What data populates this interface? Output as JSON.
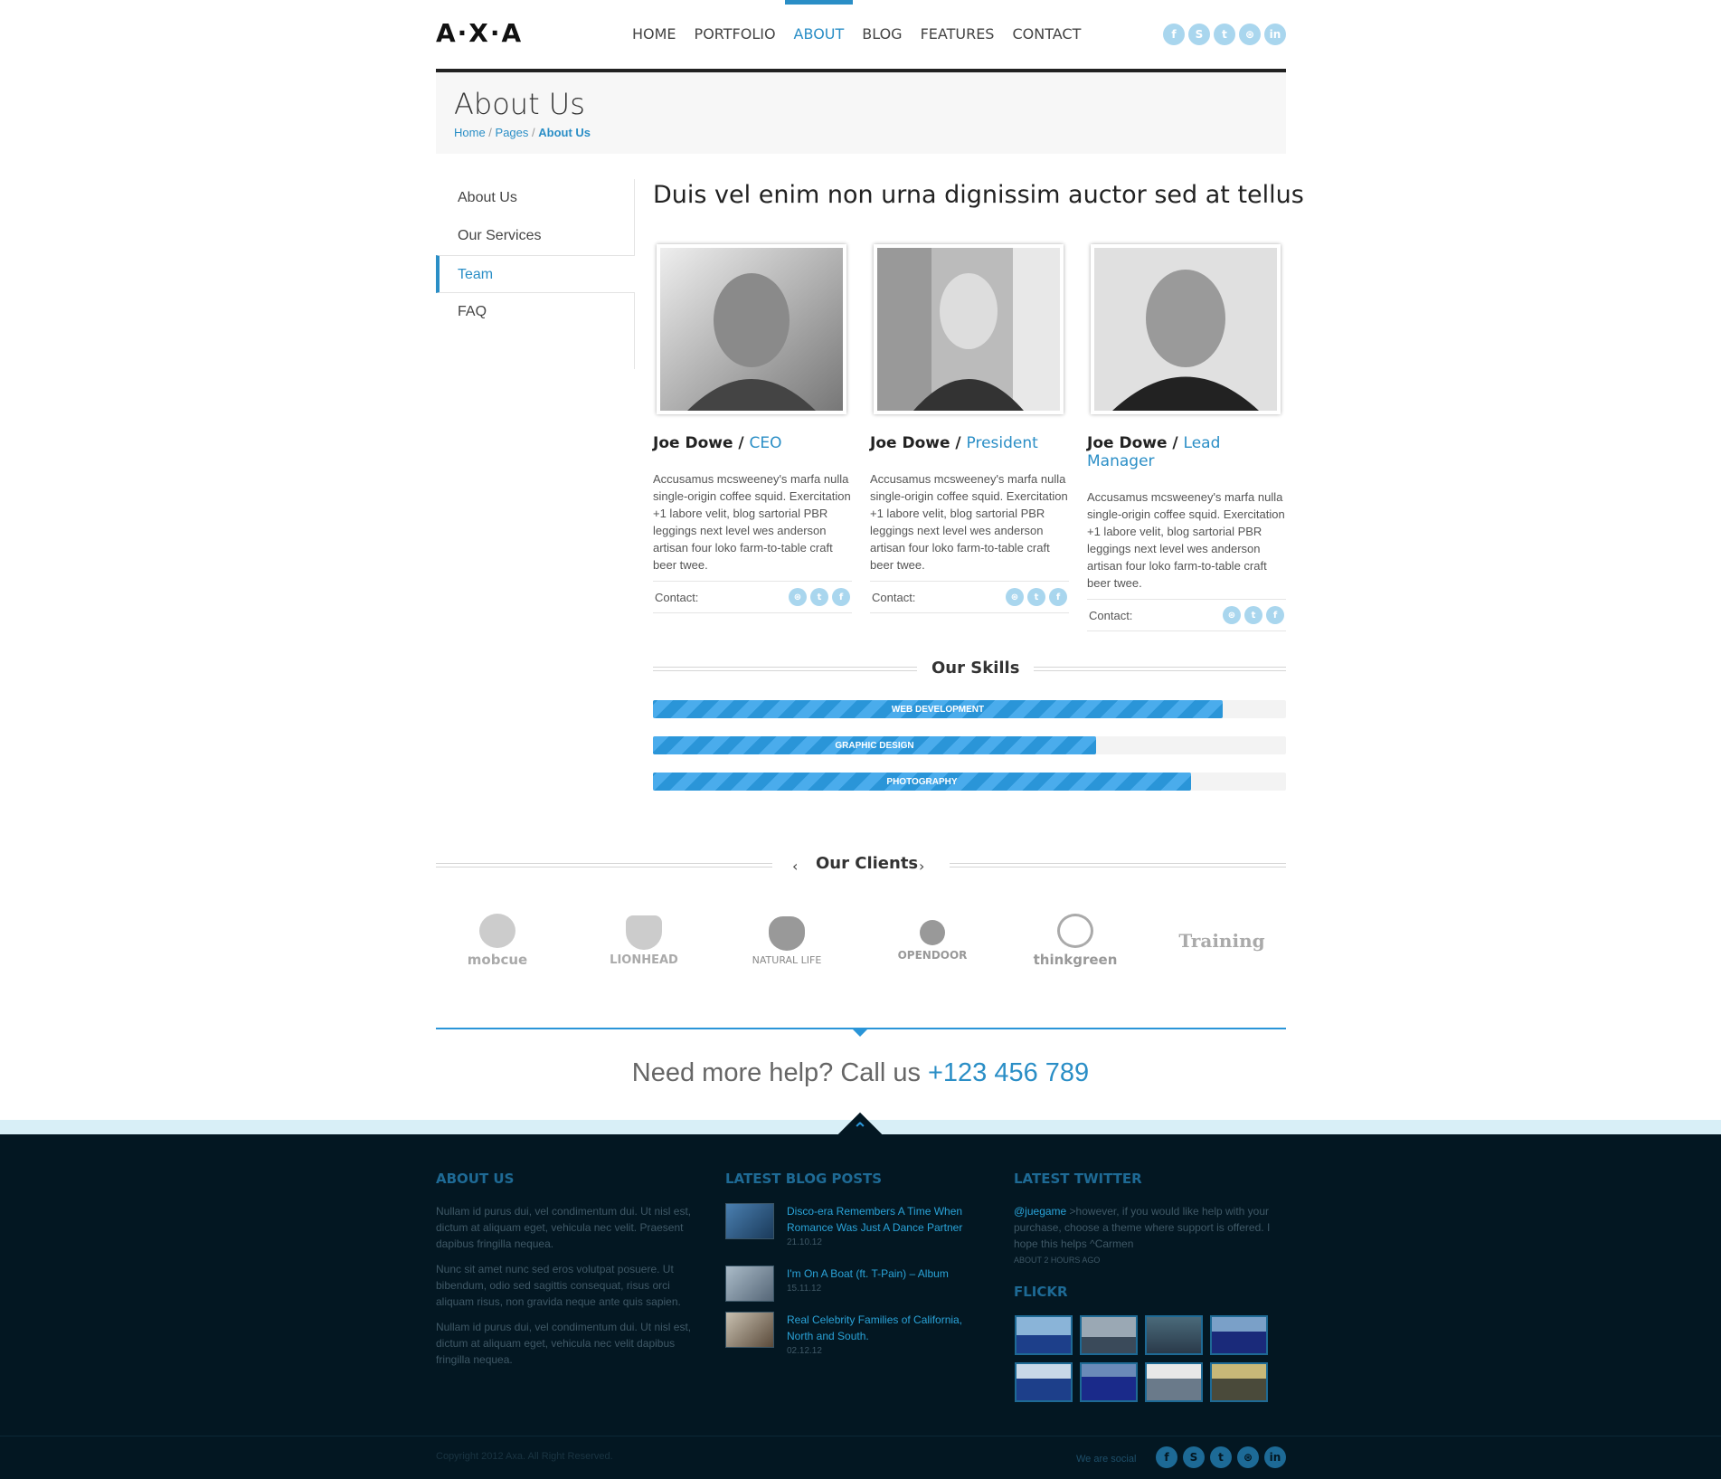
{
  "header": {
    "logo": "A·X·A",
    "nav": [
      "HOME",
      "PORTFOLIO",
      "ABOUT",
      "BLOG",
      "FEATURES",
      "CONTACT"
    ],
    "active_nav": "ABOUT",
    "social_icons": [
      "facebook-icon",
      "skype-icon",
      "twitter-icon",
      "dribbble-icon",
      "linkedin-icon"
    ]
  },
  "page_title": "About Us",
  "breadcrumb": {
    "home": "Home",
    "sep1": " / ",
    "pages": "Pages",
    "sep2": " / ",
    "current": "About Us"
  },
  "sidebar": {
    "items": [
      {
        "label": "About Us"
      },
      {
        "label": "Our Services"
      },
      {
        "label": "Team"
      },
      {
        "label": "FAQ"
      }
    ],
    "active": "Team"
  },
  "main": {
    "heading": "Duis vel enim non urna dignissim auctor sed at tellus",
    "team": [
      {
        "name": "Joe Dowe /",
        "role": "CEO",
        "bio": "Accusamus mcsweeney's marfa nulla single-origin coffee squid. Exercitation +1 labore velit, blog sartorial PBR leggings next level wes anderson artisan four loko farm-to-table craft beer twee.",
        "contact_label": "Contact:"
      },
      {
        "name": "Joe Dowe /",
        "role": "President",
        "bio": "Accusamus mcsweeney's marfa nulla single-origin coffee squid. Exercitation +1 labore velit, blog sartorial PBR leggings next level wes anderson artisan four loko farm-to-table craft beer twee.",
        "contact_label": "Contact:"
      },
      {
        "name": "Joe Dowe /",
        "role": "Lead Manager",
        "bio": "Accusamus mcsweeney's marfa nulla single-origin coffee squid. Exercitation +1 labore velit, blog sartorial PBR leggings next level wes anderson artisan four loko farm-to-table craft beer twee.",
        "contact_label": "Contact:"
      }
    ]
  },
  "skills": {
    "title": "Our Skills",
    "items": [
      {
        "label": "WEB DEVELOPMENT",
        "percent": 90
      },
      {
        "label": "GRAPHIC DESIGN",
        "percent": 70
      },
      {
        "label": "PHOTOGRAPHY",
        "percent": 85
      }
    ]
  },
  "clients": {
    "title": "Our Clients",
    "logos": [
      "mobcue",
      "LIONHEAD",
      "NATURAL LIFE",
      "OPENDOOR",
      "thinkgreen",
      "Training"
    ]
  },
  "help": {
    "text": "Need more help? Call us",
    "phone": "+123 456 789"
  },
  "footer": {
    "about_title": "ABOUT US",
    "about_paragraphs": [
      "Nullam id purus dui, vel condimentum dui. Ut nisl est, dictum at aliquam eget, vehicula nec velit. Praesent dapibus fringilla nequea.",
      "Nunc sit amet nunc sed eros volutpat posuere. Ut bibendum, odio sed sagittis consequat, risus orci aliquam risus, non gravida neque ante quis sapien.",
      "Nullam id purus dui, vel condimentum dui. Ut nisl est, dictum at aliquam eget, vehicula nec velit dapibus fringilla nequea."
    ],
    "blog_title": "LATEST BLOG POSTS",
    "posts": [
      {
        "title": "Disco-era Remembers A Time When Romance Was Just A Dance Partner",
        "date": "21.10.12"
      },
      {
        "title": "I'm On A Boat (ft. T-Pain) – Album",
        "date": "15.11.12"
      },
      {
        "title": "Real Celebrity Families of California, North and South.",
        "date": "02.12.12"
      }
    ],
    "twitter_title": "LATEST TWITTER",
    "tweet": {
      "handle": "@juegame",
      "text": " >however, if you would like help with your purchase, choose a theme where support is offered. I hope this helps ^Carmen",
      "ago": "ABOUT 2 HOURS AGO"
    },
    "flickr_title": "FLICKR",
    "copyright": "Copyright 2012 Axa. All Right Reserved.",
    "social_label": "We are social",
    "social_icons": [
      "facebook-icon",
      "skype-icon",
      "twitter-icon",
      "dribbble-icon",
      "linkedin-icon"
    ]
  },
  "colors": {
    "accent": "#2a8ec6",
    "footer_bg": "#031722",
    "skill_bar": "#2a95d8"
  }
}
